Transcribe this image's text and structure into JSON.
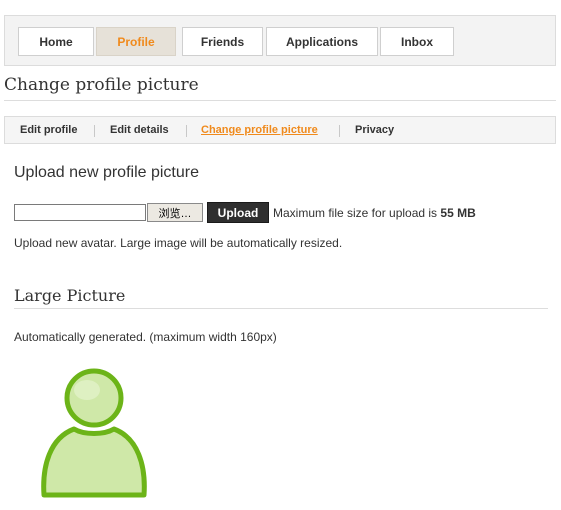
{
  "nav": {
    "tabs": [
      {
        "label": "Home"
      },
      {
        "label": "Profile",
        "active": true
      },
      {
        "label": "Friends"
      },
      {
        "label": "Applications"
      },
      {
        "label": "Inbox"
      }
    ]
  },
  "page": {
    "title": "Change profile picture"
  },
  "subnav": {
    "items": [
      {
        "label": "Edit profile"
      },
      {
        "label": "Edit details"
      },
      {
        "label": "Change profile picture",
        "active": true
      },
      {
        "label": "Privacy"
      }
    ]
  },
  "upload": {
    "heading": "Upload new profile picture",
    "file_value": "",
    "browse_label": "浏览…",
    "upload_label": "Upload",
    "max_size_prefix": "Maximum file size for upload is",
    "max_size_value": "55 MB",
    "hint": "Upload new avatar. Large image will be automatically resized."
  },
  "large": {
    "heading": "Large Picture",
    "note": "Automatically generated. (maximum width 160px)",
    "avatar_icon": "user-silhouette-icon"
  },
  "colors": {
    "accent": "#f08a1c",
    "avatar_fill": "#cfe8a8",
    "avatar_stroke": "#6cb418"
  }
}
